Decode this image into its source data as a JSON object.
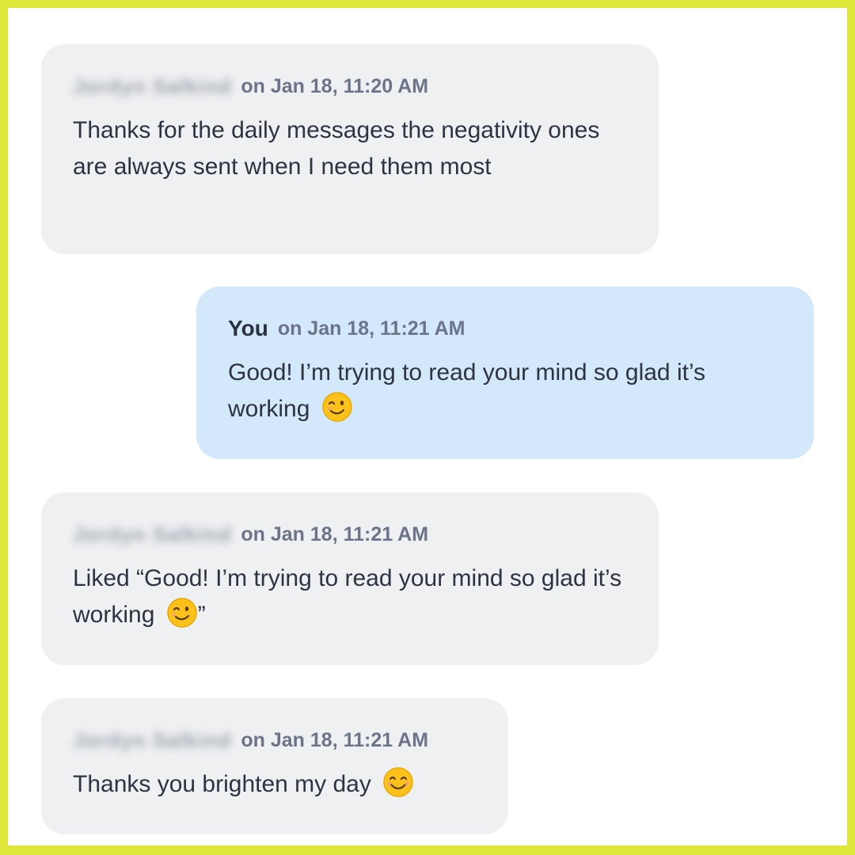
{
  "messages": [
    {
      "sender": "Jordyn Salkind",
      "timestamp": "on Jan 18, 11:20 AM",
      "text": "Thanks for the daily messages the negativity ones are always sent when I need them most"
    },
    {
      "sender": "You",
      "timestamp": "on Jan 18, 11:21 AM",
      "text": "Good! I’m trying to read your mind so glad it’s working",
      "emoji": "winking-face-emoji"
    },
    {
      "sender": "Jordyn Salkind",
      "timestamp": "on Jan 18, 11:21 AM",
      "text": "Liked “Good! I’m trying to read your mind so glad it’s working",
      "emoji": "winking-face-emoji",
      "text_suffix": "”"
    },
    {
      "sender": "Jordyn Salkind",
      "timestamp": "on Jan 18, 11:21 AM",
      "text": "Thanks you brighten my day",
      "emoji": "smiling-face-emoji"
    }
  ],
  "colors": {
    "frame_border": "#dfe63a",
    "received_bubble": "#eff0f2",
    "sent_bubble": "#d3e8fb",
    "timestamp": "#6b7488",
    "body_text": "#2d3341"
  }
}
